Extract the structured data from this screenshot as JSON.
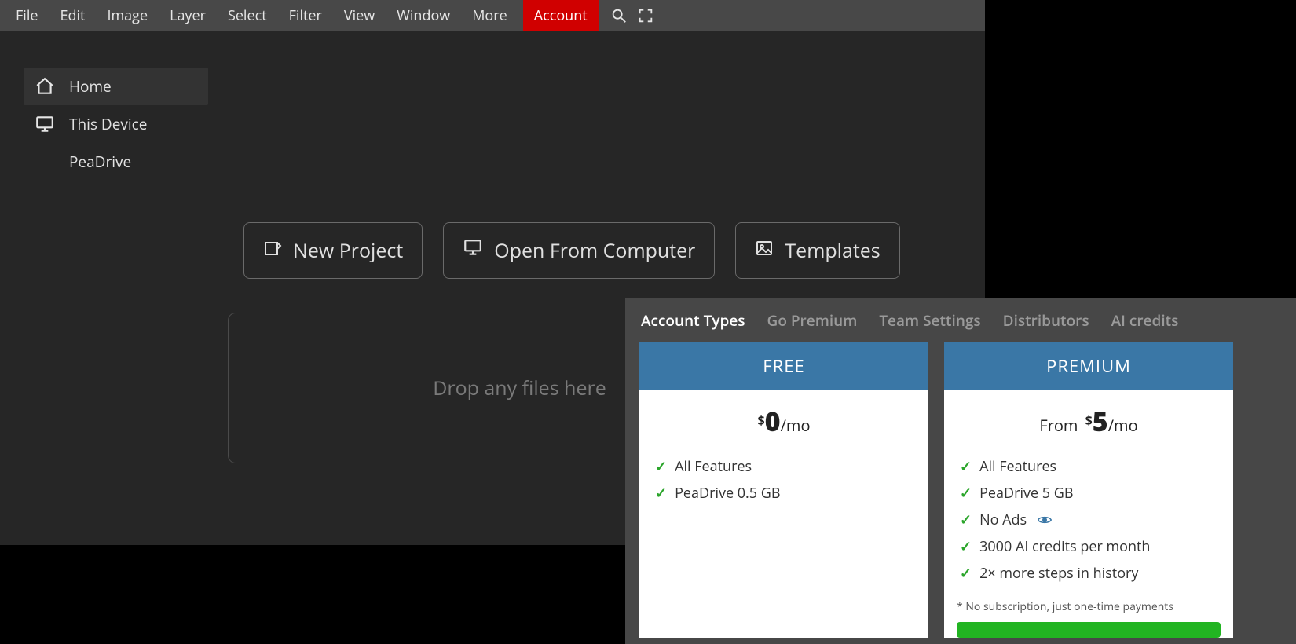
{
  "menubar": {
    "items": [
      "File",
      "Edit",
      "Image",
      "Layer",
      "Select",
      "Filter",
      "View",
      "Window",
      "More"
    ],
    "account": "Account"
  },
  "sidebar": {
    "items": [
      {
        "label": "Home"
      },
      {
        "label": "This Device"
      },
      {
        "label": "PeaDrive"
      }
    ]
  },
  "main_buttons": {
    "new_project": "New Project",
    "open_from_computer": "Open From Computer",
    "templates": "Templates"
  },
  "dropzone": {
    "text": "Drop any files here"
  },
  "account_panel": {
    "tabs": [
      "Account Types",
      "Go Premium",
      "Team Settings",
      "Distributors",
      "AI credits"
    ],
    "free": {
      "title": "FREE",
      "price_dollar": "$",
      "price_amount": "0",
      "price_per": "/mo",
      "features": [
        "All Features",
        "PeaDrive 0.5 GB"
      ]
    },
    "premium": {
      "title": "PREMIUM",
      "from": "From ",
      "price_dollar": "$",
      "price_amount": "5",
      "price_per": "/mo",
      "features": [
        "All Features",
        "PeaDrive 5 GB",
        "No Ads",
        "3000 AI credits per month",
        "2× more steps in history"
      ],
      "fineprint": "* No subscription, just one-time payments"
    }
  }
}
